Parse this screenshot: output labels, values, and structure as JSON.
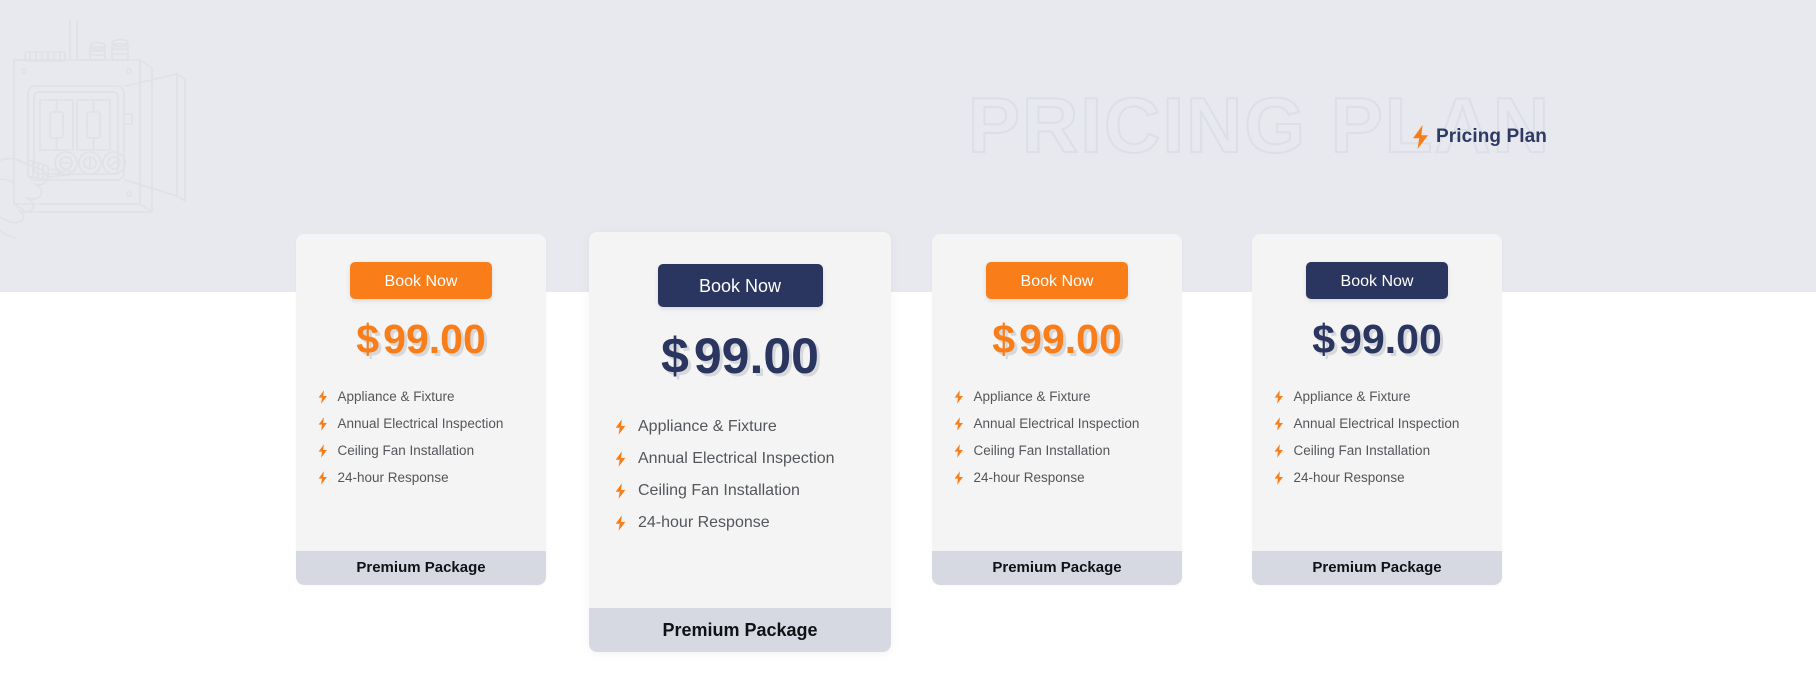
{
  "theme": {
    "band_bg": "#e7e9ee",
    "page_bg": "#ffffff",
    "card_bg": "#f4f4f4",
    "footer_bg": "#d6d9e1",
    "accent_orange": "#f97d18",
    "accent_navy": "#2a3560",
    "feature_text": "#53565a",
    "watermark_stroke": "#dcdfe6",
    "art_stroke": "#dfe1e7"
  },
  "header": {
    "watermark_text": "PRICING PLAN",
    "label_text": "Pricing Plan",
    "label_icon": "lightning-bolt-icon"
  },
  "illustration": {
    "name": "electrical-panel-hand-line-art"
  },
  "cards": [
    {
      "id": "card-1",
      "variant": "standard",
      "button_label": "Book Now",
      "button_style": "orange",
      "currency": "$",
      "amount": "99.00",
      "price_style": "orange",
      "features": [
        "Appliance & Fixture",
        "Annual Electrical Inspection",
        "Ceiling Fan Installation",
        "24-hour Response"
      ],
      "footer_label": "Premium Package"
    },
    {
      "id": "card-2",
      "variant": "featured",
      "button_label": "Book Now",
      "button_style": "navy",
      "currency": "$",
      "amount": "99.00",
      "price_style": "navy",
      "features": [
        "Appliance & Fixture",
        "Annual Electrical Inspection",
        "Ceiling Fan Installation",
        "24-hour Response"
      ],
      "footer_label": "Premium Package"
    },
    {
      "id": "card-3",
      "variant": "standard",
      "button_label": "Book Now",
      "button_style": "orange",
      "currency": "$",
      "amount": "99.00",
      "price_style": "orange",
      "features": [
        "Appliance & Fixture",
        "Annual Electrical Inspection",
        "Ceiling Fan Installation",
        "24-hour Response"
      ],
      "footer_label": "Premium Package"
    },
    {
      "id": "card-4",
      "variant": "standard",
      "button_label": "Book Now",
      "button_style": "navy",
      "currency": "$",
      "amount": "99.00",
      "price_style": "navy",
      "features": [
        "Appliance & Fixture",
        "Annual Electrical Inspection",
        "Ceiling Fan Installation",
        "24-hour Response"
      ],
      "footer_label": "Premium Package"
    }
  ]
}
